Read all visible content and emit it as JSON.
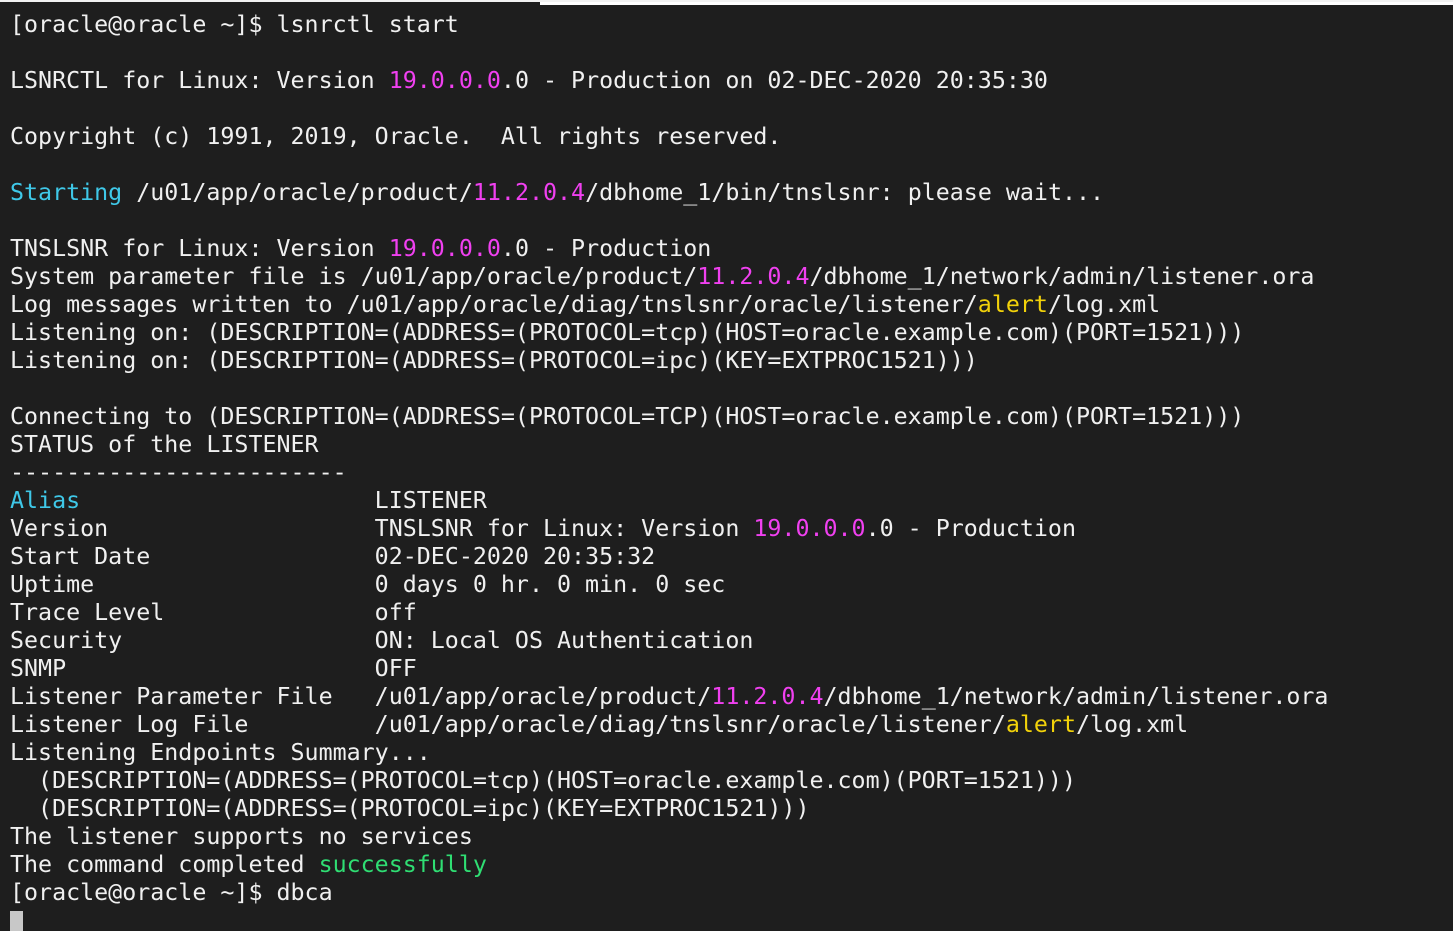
{
  "colors": {
    "background": "#1e1e1e",
    "foreground": "#f0f0f0",
    "cyan": "#3fc8e8",
    "magenta": "#f040f0",
    "yellow": "#f2d20a",
    "green": "#2fde73"
  },
  "lines": [
    [
      {
        "t": "[oracle@oracle ~]$ lsnrctl start"
      }
    ],
    [],
    [
      {
        "t": "LSNRCTL for Linux: Version "
      },
      {
        "t": "19.0.0.0",
        "c": "magenta"
      },
      {
        "t": ".0 - Production on 02-DEC-2020 20:35:30"
      }
    ],
    [],
    [
      {
        "t": "Copyright (c) 1991, 2019, Oracle.  All rights reserved."
      }
    ],
    [],
    [
      {
        "t": "Starting",
        "c": "cyan"
      },
      {
        "t": " /u01/app/oracle/product/"
      },
      {
        "t": "11.2.0.4",
        "c": "magenta"
      },
      {
        "t": "/dbhome_1/bin/tnslsnr: please wait..."
      }
    ],
    [],
    [
      {
        "t": "TNSLSNR for Linux: Version "
      },
      {
        "t": "19.0.0.0",
        "c": "magenta"
      },
      {
        "t": ".0 - Production"
      }
    ],
    [
      {
        "t": "System parameter file is /u01/app/oracle/product/"
      },
      {
        "t": "11.2.0.4",
        "c": "magenta"
      },
      {
        "t": "/dbhome_1/network/admin/listener.ora"
      }
    ],
    [
      {
        "t": "Log messages written to /u01/app/oracle/diag/tnslsnr/oracle/listener/"
      },
      {
        "t": "alert",
        "c": "yellow"
      },
      {
        "t": "/log.xml"
      }
    ],
    [
      {
        "t": "Listening on: (DESCRIPTION=(ADDRESS=(PROTOCOL=tcp)(HOST=oracle.example.com)(PORT=1521)))"
      }
    ],
    [
      {
        "t": "Listening on: (DESCRIPTION=(ADDRESS=(PROTOCOL=ipc)(KEY=EXTPROC1521)))"
      }
    ],
    [],
    [
      {
        "t": "Connecting to (DESCRIPTION=(ADDRESS=(PROTOCOL=TCP)(HOST=oracle.example.com)(PORT=1521)))"
      }
    ],
    [
      {
        "t": "STATUS of the LISTENER"
      }
    ],
    [
      {
        "t": "------------------------"
      }
    ],
    [
      {
        "t": "Alias",
        "c": "cyan"
      },
      {
        "t": "                     LISTENER"
      }
    ],
    [
      {
        "t": "Version                   TNSLSNR for Linux: Version "
      },
      {
        "t": "19.0.0.0",
        "c": "magenta"
      },
      {
        "t": ".0 - Production"
      }
    ],
    [
      {
        "t": "Start Date                02-DEC-2020 20:35:32"
      }
    ],
    [
      {
        "t": "Uptime                    0 days 0 hr. 0 min. 0 sec"
      }
    ],
    [
      {
        "t": "Trace Level               off"
      }
    ],
    [
      {
        "t": "Security                  ON: Local OS Authentication"
      }
    ],
    [
      {
        "t": "SNMP                      OFF"
      }
    ],
    [
      {
        "t": "Listener Parameter File   /u01/app/oracle/product/"
      },
      {
        "t": "11.2.0.4",
        "c": "magenta"
      },
      {
        "t": "/dbhome_1/network/admin/listener.ora"
      }
    ],
    [
      {
        "t": "Listener Log File         /u01/app/oracle/diag/tnslsnr/oracle/listener/"
      },
      {
        "t": "alert",
        "c": "yellow"
      },
      {
        "t": "/log.xml"
      }
    ],
    [
      {
        "t": "Listening Endpoints Summary..."
      }
    ],
    [
      {
        "t": "  (DESCRIPTION=(ADDRESS=(PROTOCOL=tcp)(HOST=oracle.example.com)(PORT=1521)))"
      }
    ],
    [
      {
        "t": "  (DESCRIPTION=(ADDRESS=(PROTOCOL=ipc)(KEY=EXTPROC1521)))"
      }
    ],
    [
      {
        "t": "The listener supports no services"
      }
    ],
    [
      {
        "t": "The command completed "
      },
      {
        "t": "successfully",
        "c": "green"
      }
    ],
    [
      {
        "t": "[oracle@oracle ~]$ dbca"
      }
    ]
  ]
}
